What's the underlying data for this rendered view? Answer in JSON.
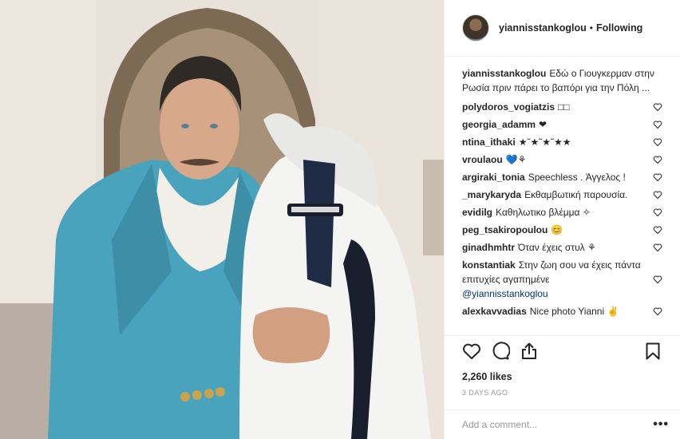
{
  "header": {
    "username": "yiannisstankoglou",
    "separator": "•",
    "follow_status": "Following"
  },
  "caption": {
    "username": "yiannisstankoglou",
    "text": "Εδώ ο Γιουγκερμαν στην Ρωσία πριν πάρει το βαπόρι για την Πόλη ..."
  },
  "comments": [
    {
      "username": "polydoros_vogiatzis",
      "text": "□□"
    },
    {
      "username": "georgia_adamm",
      "text": "❤"
    },
    {
      "username": "ntina_ithaki",
      "text": "★˜★˜★˜★★"
    },
    {
      "username": "vroulaou",
      "text": "💙⚘"
    },
    {
      "username": "argiraki_tonia",
      "text": "Speechless . Άγγελος !"
    },
    {
      "username": "_marykaryda",
      "text": "Εκθαμβωτική παρουσία."
    },
    {
      "username": "evidilg",
      "text": "Καθηλωτικο βλέμμα ✧"
    },
    {
      "username": "peg_tsakiropoulou",
      "text": "😊"
    },
    {
      "username": "ginadhmhtr",
      "text": "Όταν έχεις στυλ ⚘"
    },
    {
      "username": "konstantiak",
      "text": "Στην ζωη σου να έχεις πάντα επιτυχίες αγαπημένε",
      "mention": "@yiannisstankoglou"
    },
    {
      "username": "alexkavvadias",
      "text": "Nice photo Yianni ✌"
    }
  ],
  "likes": "2,260 likes",
  "date": "3 DAYS AGO",
  "add_comment": {
    "placeholder": "Add a comment..."
  },
  "more_label": "•••",
  "icons": {
    "like": "heart-outline-icon",
    "comment": "speech-bubble-icon",
    "share": "share-upload-icon",
    "save": "bookmark-icon"
  }
}
